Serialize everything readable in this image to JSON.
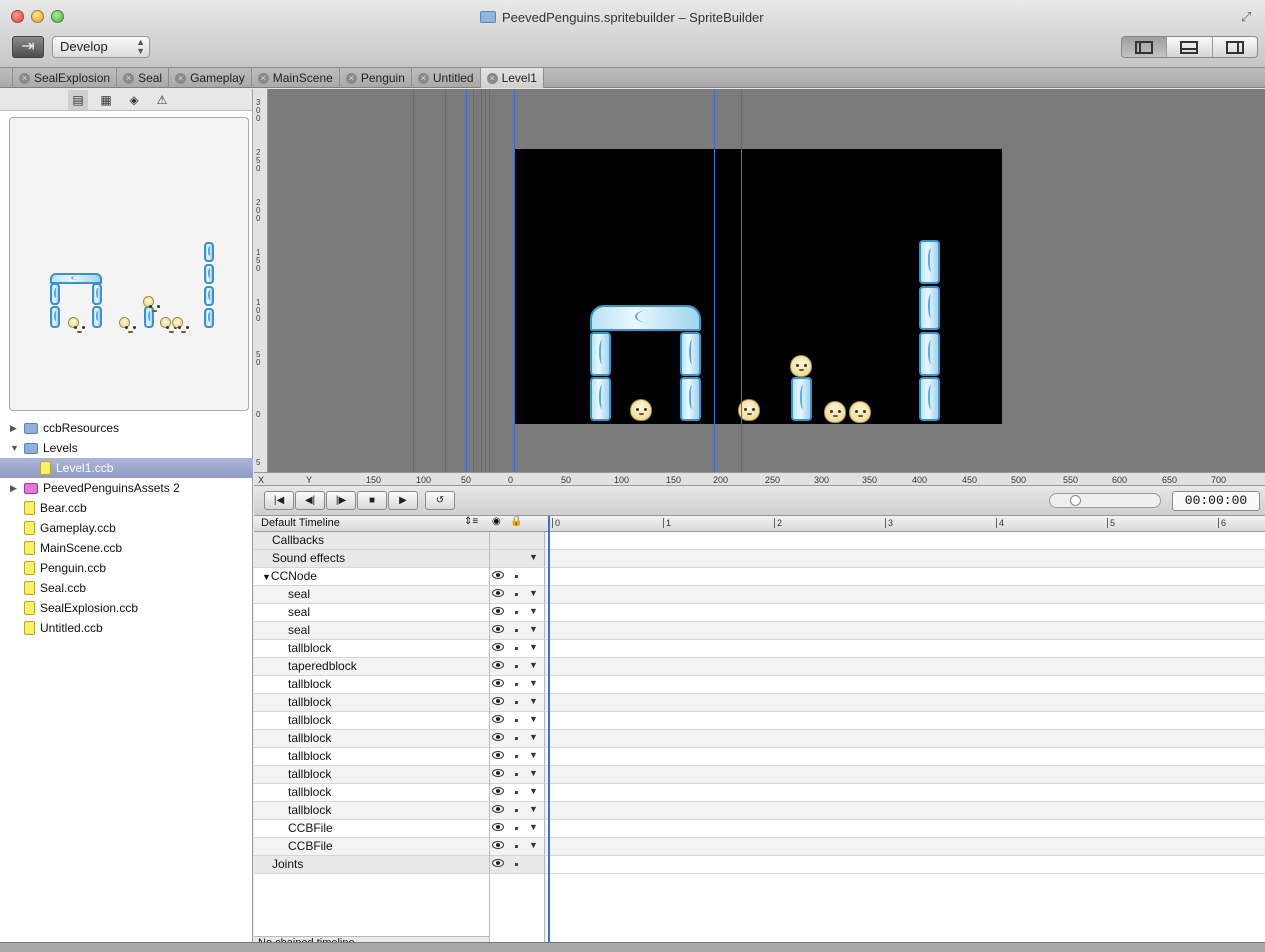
{
  "window": {
    "title": "PeevedPenguins.spritebuilder – SpriteBuilder",
    "mode": "Develop"
  },
  "tabs": [
    "SealExplosion",
    "Seal",
    "Gameplay",
    "MainScene",
    "Penguin",
    "Untitled",
    "Level1"
  ],
  "active_tab": "Level1",
  "file_tree": [
    {
      "label": "ccbResources",
      "type": "folder",
      "expandable": true
    },
    {
      "label": "Levels",
      "type": "folder",
      "expanded": true
    },
    {
      "label": "Level1.ccb",
      "type": "file",
      "selected": true,
      "indent": true
    },
    {
      "label": "PeevedPenguinsAssets 2",
      "type": "pink",
      "expandable": true
    },
    {
      "label": "Bear.ccb",
      "type": "file"
    },
    {
      "label": "Gameplay.ccb",
      "type": "file"
    },
    {
      "label": "MainScene.ccb",
      "type": "file"
    },
    {
      "label": "Penguin.ccb",
      "type": "file"
    },
    {
      "label": "Seal.ccb",
      "type": "file"
    },
    {
      "label": "SealExplosion.ccb",
      "type": "file"
    },
    {
      "label": "Untitled.ccb",
      "type": "file"
    }
  ],
  "ruler_h": {
    "axis_x": "X",
    "axis_y": "Y",
    "labels": [
      "150",
      "100",
      "50",
      "0",
      "50",
      "100",
      "150",
      "200",
      "250",
      "300",
      "350",
      "400",
      "450",
      "500",
      "550",
      "600",
      "650",
      "700"
    ]
  },
  "ruler_v": {
    "labels": [
      "3 0 0",
      "2 5 0",
      "2 0 0",
      "1 5 0",
      "1 0 0",
      "5 0",
      "0",
      "5"
    ]
  },
  "timeline": {
    "name": "Default Timeline",
    "time": "00:00:00",
    "scale_labels": [
      "0",
      "1",
      "2",
      "3",
      "4",
      "5",
      "6"
    ],
    "rows": [
      {
        "label": "Callbacks",
        "kind": "top"
      },
      {
        "label": "Sound effects",
        "kind": "top"
      },
      {
        "label": "CCNode",
        "kind": "root"
      },
      {
        "label": "seal"
      },
      {
        "label": "seal"
      },
      {
        "label": "seal"
      },
      {
        "label": "tallblock"
      },
      {
        "label": "taperedblock"
      },
      {
        "label": "tallblock"
      },
      {
        "label": "tallblock"
      },
      {
        "label": "tallblock"
      },
      {
        "label": "tallblock"
      },
      {
        "label": "tallblock"
      },
      {
        "label": "tallblock"
      },
      {
        "label": "tallblock"
      },
      {
        "label": "tallblock"
      },
      {
        "label": "CCBFile"
      },
      {
        "label": "CCBFile"
      },
      {
        "label": "Joints",
        "kind": "top"
      }
    ],
    "status": "No chained timeline"
  },
  "colors": {
    "guide": "#3a6fd8",
    "stage": "#000000",
    "canvas_bg": "#7b7b7b"
  }
}
